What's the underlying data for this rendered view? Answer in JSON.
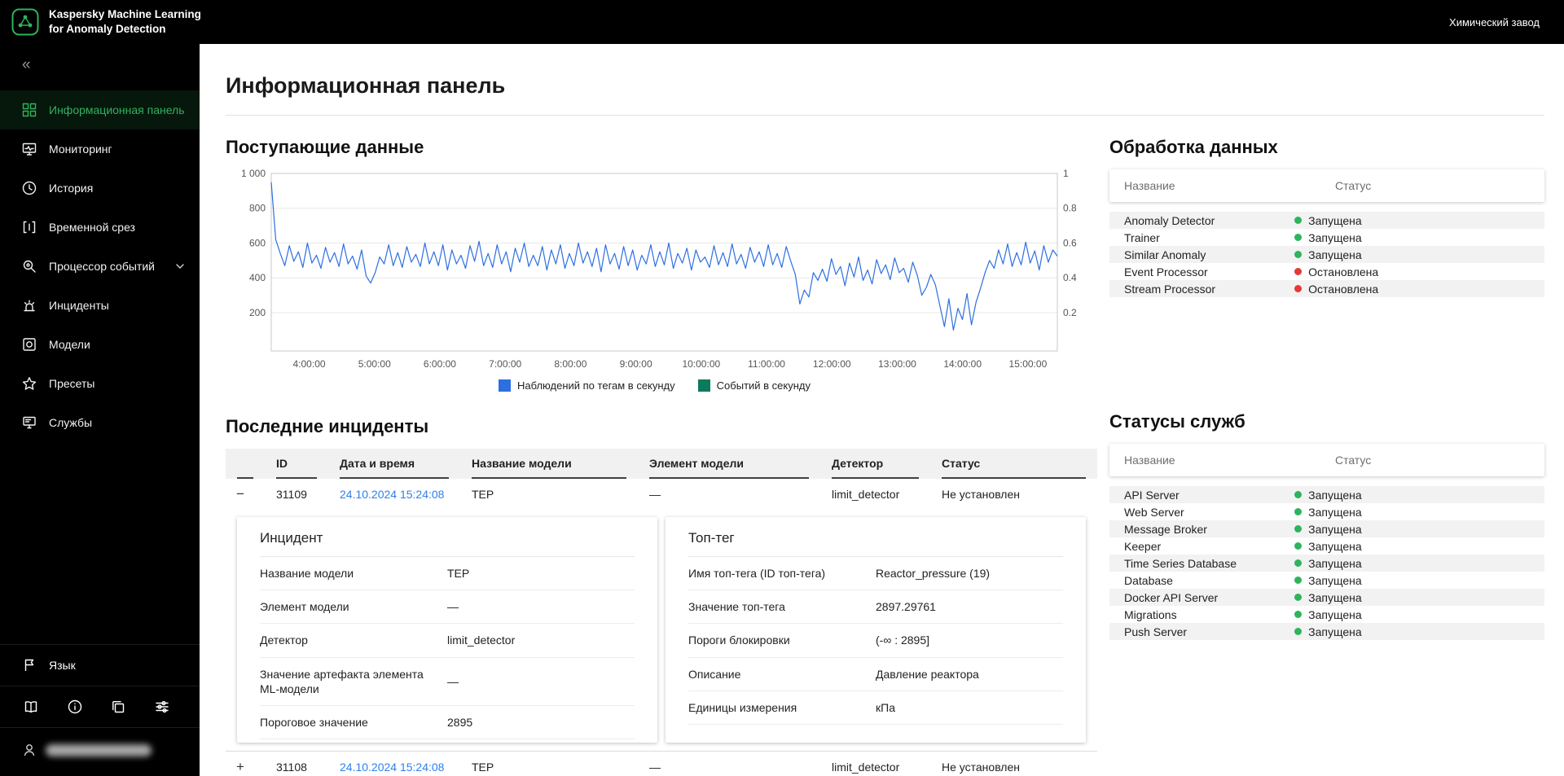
{
  "app": {
    "title_line1": "Kaspersky Machine Learning",
    "title_line2": "for Anomaly Detection",
    "tenant": "Химический завод"
  },
  "sidebar": {
    "collapse_icon": "«",
    "language_label": "Язык",
    "items": [
      {
        "key": "dashboard",
        "label": "Информационная панель",
        "active": true
      },
      {
        "key": "monitoring",
        "label": "Мониторинг"
      },
      {
        "key": "history",
        "label": "История"
      },
      {
        "key": "time-slice",
        "label": "Временной срез"
      },
      {
        "key": "event-processor",
        "label": "Процессор событий",
        "expandable": true
      },
      {
        "key": "incidents",
        "label": "Инциденты"
      },
      {
        "key": "models",
        "label": "Модели"
      },
      {
        "key": "presets",
        "label": "Пресеты"
      },
      {
        "key": "services",
        "label": "Службы"
      }
    ],
    "footer_icons": [
      "book",
      "info",
      "docs",
      "settings"
    ]
  },
  "page": {
    "title": "Информационная панель"
  },
  "sections": {
    "incoming_title": "Поступающие данные",
    "processing_title": "Обработка данных",
    "incidents_title": "Последние инциденты",
    "services_title": "Статусы служб"
  },
  "chart_data": {
    "type": "line",
    "title": "Поступающие данные",
    "x_range_hours": [
      3.42,
      15.45
    ],
    "ylim": [
      -20,
      1000
    ],
    "grid": true,
    "legend_position": "bottom",
    "x_ticks": [
      {
        "label": "4:00:00",
        "hour": 4
      },
      {
        "label": "5:00:00",
        "hour": 5
      },
      {
        "label": "6:00:00",
        "hour": 6
      },
      {
        "label": "7:00:00",
        "hour": 7
      },
      {
        "label": "8:00:00",
        "hour": 8
      },
      {
        "label": "9:00:00",
        "hour": 9
      },
      {
        "label": "10:00:00",
        "hour": 10
      },
      {
        "label": "11:00:00",
        "hour": 11
      },
      {
        "label": "12:00:00",
        "hour": 12
      },
      {
        "label": "13:00:00",
        "hour": 13
      },
      {
        "label": "14:00:00",
        "hour": 14
      },
      {
        "label": "15:00:00",
        "hour": 15
      }
    ],
    "y_left_ticks": [
      {
        "label": "1 000",
        "value": 1000
      },
      {
        "label": "800",
        "value": 800
      },
      {
        "label": "600",
        "value": 600
      },
      {
        "label": "400",
        "value": 400
      },
      {
        "label": "200",
        "value": 200
      }
    ],
    "y_right_ticks": [
      {
        "label": "1",
        "pos": 1000
      },
      {
        "label": "0.8",
        "pos": 800
      },
      {
        "label": "0.6",
        "pos": 600
      },
      {
        "label": "0.4",
        "pos": 400
      },
      {
        "label": "0.2",
        "pos": 200
      }
    ],
    "series": [
      {
        "name": "Наблюдений по тегам в секунду",
        "color": "#2d6fe0",
        "values": [
          950,
          620,
          540,
          470,
          585,
          495,
          550,
          460,
          600,
          485,
          530,
          455,
          575,
          490,
          545,
          465,
          595,
          480,
          525,
          450,
          560,
          410,
          370,
          430,
          520,
          480,
          590,
          470,
          545,
          460,
          580,
          490,
          535,
          465,
          600,
          480,
          550,
          470,
          590,
          445,
          560,
          480,
          530,
          455,
          585,
          495,
          610,
          470,
          540,
          460,
          590,
          480,
          550,
          435,
          570,
          490,
          600,
          465,
          530,
          470,
          580,
          445,
          560,
          480,
          590,
          455,
          540,
          470,
          600,
          485,
          550,
          465,
          570,
          435,
          590,
          480,
          540,
          450,
          580,
          470,
          560,
          445,
          530,
          480,
          590,
          465,
          550,
          475,
          600,
          455,
          540,
          485,
          570,
          445,
          560,
          490,
          520,
          460,
          585,
          475,
          545,
          465,
          595,
          480,
          535,
          455,
          575,
          490,
          550,
          465,
          590,
          475,
          540,
          460,
          580,
          495,
          420,
          250,
          330,
          290,
          430,
          385,
          450,
          380,
          510,
          420,
          465,
          355,
          485,
          405,
          520,
          385,
          445,
          365,
          505,
          425,
          475,
          390,
          515,
          430,
          455,
          375,
          490,
          415,
          300,
          345,
          420,
          360,
          240,
          120,
          280,
          100,
          225,
          160,
          310,
          130,
          260,
          340,
          430,
          500,
          455,
          560,
          480,
          595,
          465,
          545,
          475,
          605,
          485,
          555,
          445,
          585,
          490,
          560,
          525
        ]
      },
      {
        "name": "Событий в секунду",
        "color": "#0d7a5b",
        "values": []
      }
    ]
  },
  "processing": {
    "columns": [
      "Название",
      "Статус"
    ],
    "rows": [
      {
        "name": "Anomaly Detector",
        "status": "Запущена",
        "state": "running"
      },
      {
        "name": "Trainer",
        "status": "Запущена",
        "state": "running"
      },
      {
        "name": "Similar Anomaly",
        "status": "Запущена",
        "state": "running"
      },
      {
        "name": "Event Processor",
        "status": "Остановлена",
        "state": "stopped"
      },
      {
        "name": "Stream Processor",
        "status": "Остановлена",
        "state": "stopped"
      }
    ]
  },
  "services": {
    "columns": [
      "Название",
      "Статус"
    ],
    "rows": [
      {
        "name": "API Server",
        "status": "Запущена",
        "state": "running"
      },
      {
        "name": "Web Server",
        "status": "Запущена",
        "state": "running"
      },
      {
        "name": "Message Broker",
        "status": "Запущена",
        "state": "running"
      },
      {
        "name": "Keeper",
        "status": "Запущена",
        "state": "running"
      },
      {
        "name": "Time Series Database",
        "status": "Запущена",
        "state": "running"
      },
      {
        "name": "Database",
        "status": "Запущена",
        "state": "running"
      },
      {
        "name": "Docker API Server",
        "status": "Запущена",
        "state": "running"
      },
      {
        "name": "Migrations",
        "status": "Запущена",
        "state": "running"
      },
      {
        "name": "Push Server",
        "status": "Запущена",
        "state": "running"
      }
    ]
  },
  "incidents": {
    "columns": [
      "",
      "ID",
      "Дата и время",
      "Название модели",
      "Элемент модели",
      "Детектор",
      "Статус"
    ],
    "rows": [
      {
        "toggle": "−",
        "id": "31109",
        "datetime": "24.10.2024 15:24:08",
        "model": "ТЕР",
        "element": "—",
        "detector": "limit_detector",
        "status": "Не установлен",
        "expanded": true
      },
      {
        "toggle": "+",
        "id": "31108",
        "datetime": "24.10.2024 15:24:08",
        "model": "ТЕР",
        "element": "—",
        "detector": "limit_detector",
        "status": "Не установлен",
        "expanded": false
      }
    ]
  },
  "detail": {
    "incident": {
      "title": "Инцидент",
      "rows": [
        {
          "label": "Название модели",
          "value": "ТЕР"
        },
        {
          "label": "Элемент модели",
          "value": "—"
        },
        {
          "label": "Детектор",
          "value": "limit_detector"
        },
        {
          "label": "Значение артефакта элемента ML-модели",
          "value": "—"
        },
        {
          "label": "Пороговое значение",
          "value": "2895"
        }
      ]
    },
    "toptag": {
      "title": "Топ-тег",
      "rows": [
        {
          "label": "Имя топ-тега (ID топ-тега)",
          "value": "Reactor_pressure (19)"
        },
        {
          "label": "Значение топ-тега",
          "value": "2897.29761"
        },
        {
          "label": "Пороги блокировки",
          "value": "(-∞ : 2895]"
        },
        {
          "label": "Описание",
          "value": "Давление реактора"
        },
        {
          "label": "Единицы измерения",
          "value": "кПа"
        }
      ]
    }
  },
  "colors": {
    "accent_green": "#2eb45c",
    "status_running": "#2eb45c",
    "status_stopped": "#e53935",
    "link_blue": "#2f80ed",
    "chart_blue": "#2d6fe0",
    "chart_green": "#0d7a5b"
  }
}
